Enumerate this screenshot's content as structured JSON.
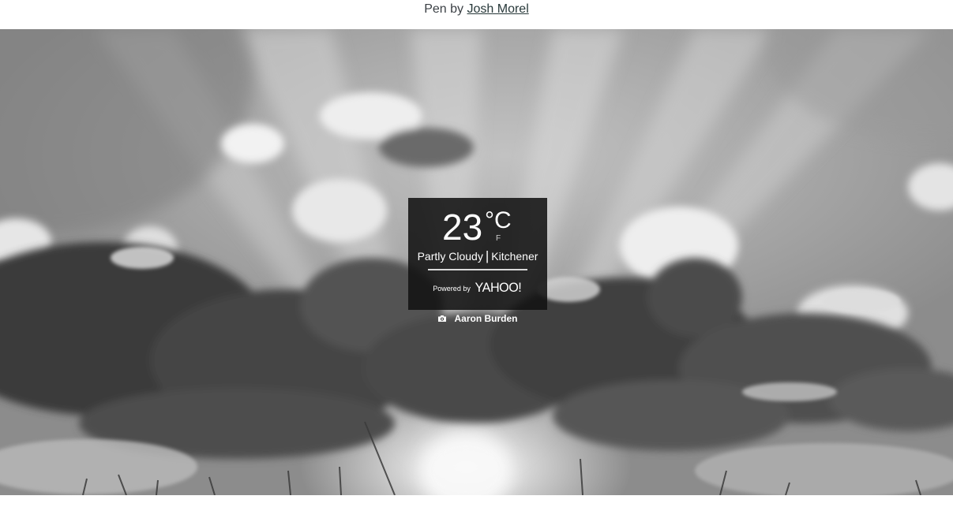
{
  "header": {
    "prefix": "Pen by",
    "author": "Josh Morel"
  },
  "weather": {
    "temperature": "23",
    "unit_celsius": "°C",
    "unit_fahrenheit": "F",
    "condition": "Partly Cloudy",
    "separator": "|",
    "location": "Kitchener",
    "powered_by": "Powered by",
    "provider": "YAHOO!"
  },
  "photo_credit": {
    "icon": "camera-icon",
    "name": "Aaron Burden"
  },
  "colors": {
    "widget_bg": "#121212",
    "text": "#ffffff",
    "link": "#28393a"
  }
}
